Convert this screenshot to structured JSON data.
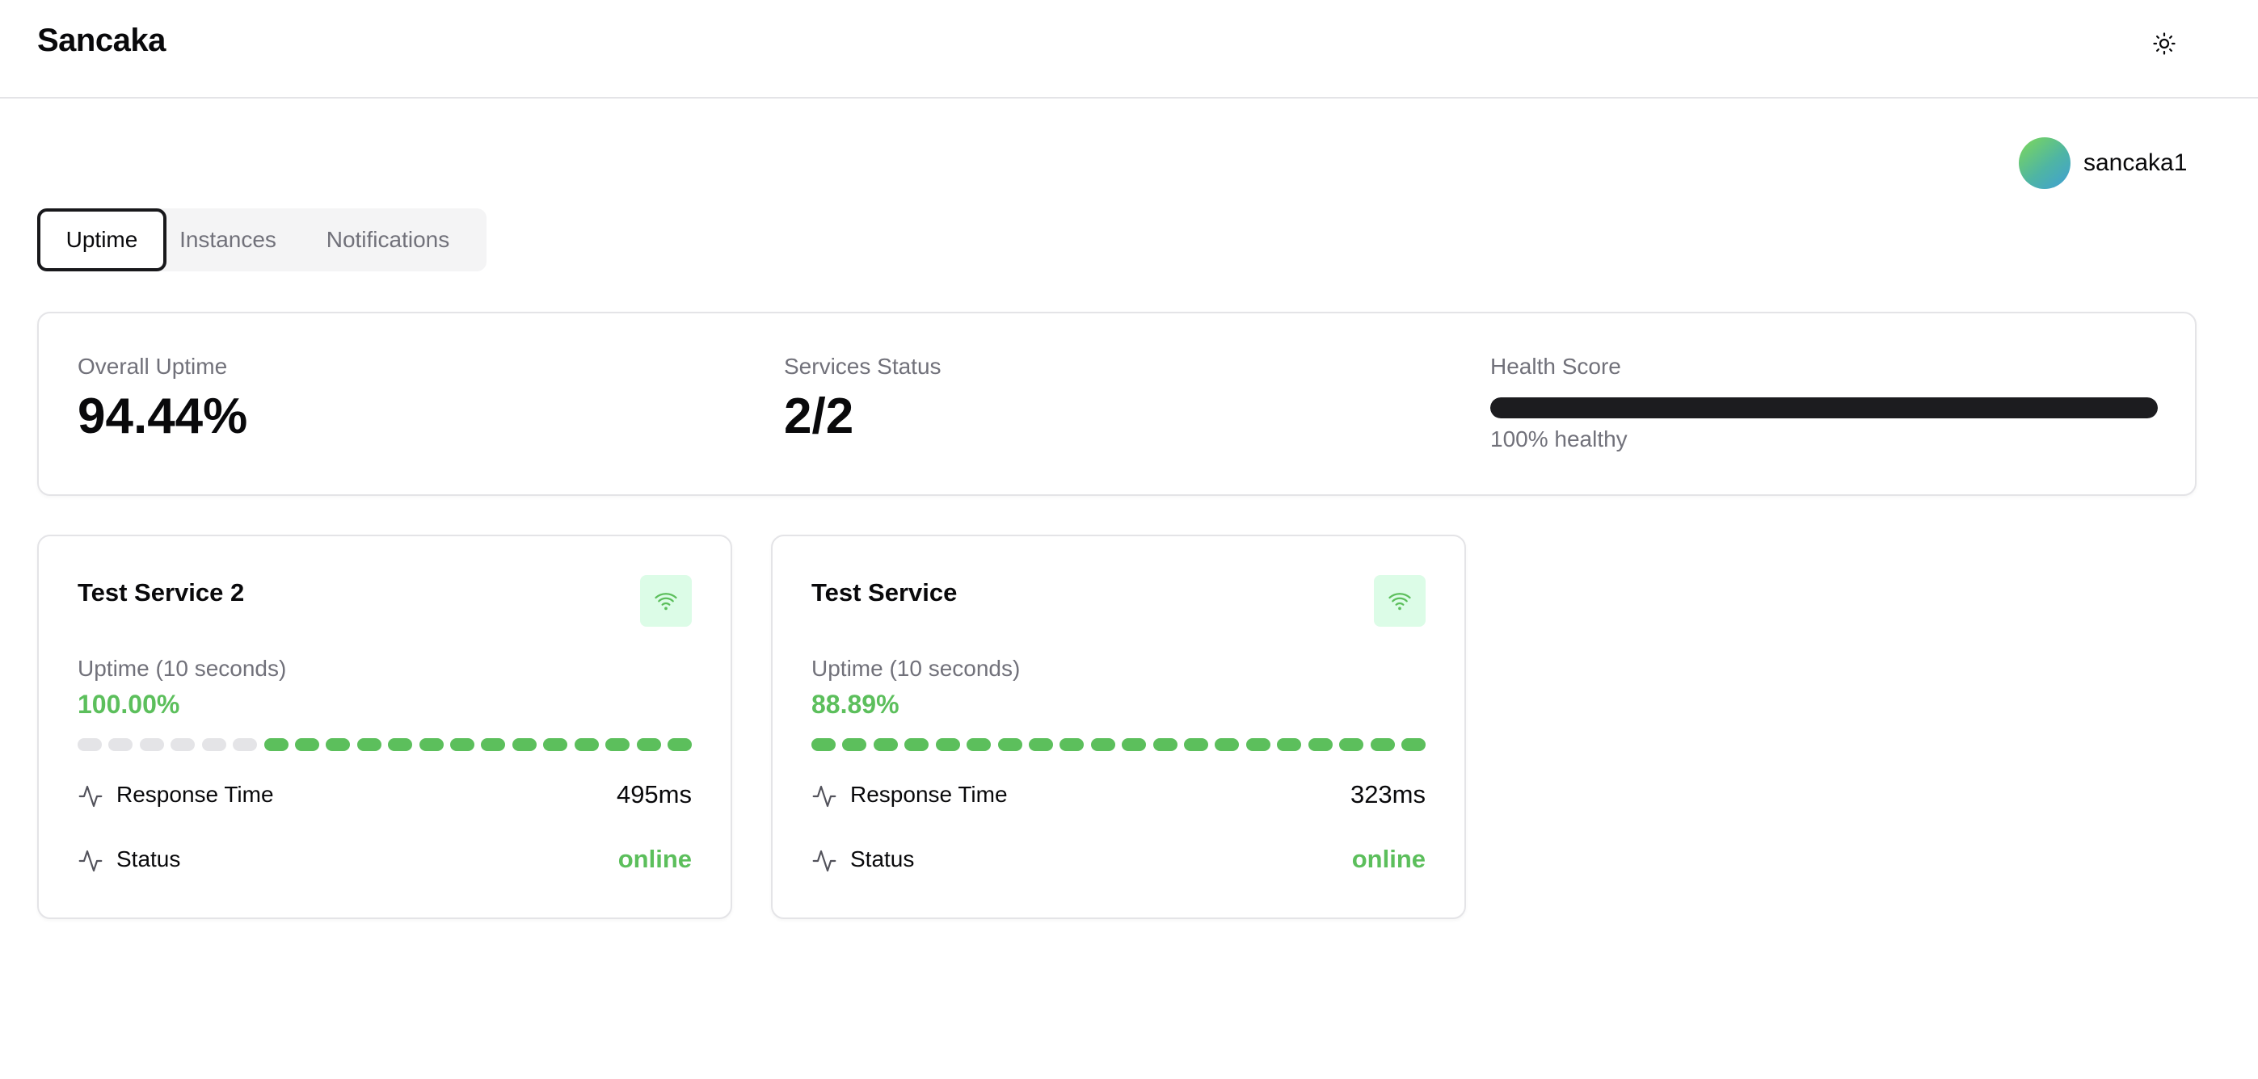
{
  "app": {
    "title": "Sancaka"
  },
  "header": {
    "theme_icon": "sun-icon"
  },
  "user": {
    "name": "sancaka1"
  },
  "tabs": [
    {
      "label": "Uptime",
      "active": true
    },
    {
      "label": "Instances",
      "active": false
    },
    {
      "label": "Notifications",
      "active": false
    }
  ],
  "summary": {
    "overall_uptime_label": "Overall Uptime",
    "overall_uptime_value": "94.44%",
    "services_status_label": "Services Status",
    "services_status_value": "2/2",
    "health_label": "Health Score",
    "health_percent": 100,
    "health_text": "100% healthy"
  },
  "services": [
    {
      "name": "Test Service 2",
      "status_icon": "wifi-icon",
      "uptime_label": "Uptime (10 seconds)",
      "uptime_value": "100.00%",
      "beats": [
        "empty",
        "empty",
        "empty",
        "empty",
        "empty",
        "empty",
        "up",
        "up",
        "up",
        "up",
        "up",
        "up",
        "up",
        "up",
        "up",
        "up",
        "up",
        "up",
        "up",
        "up"
      ],
      "response_label": "Response Time",
      "response_value": "495ms",
      "status_label": "Status",
      "status_value": "online"
    },
    {
      "name": "Test Service",
      "status_icon": "wifi-icon",
      "uptime_label": "Uptime (10 seconds)",
      "uptime_value": "88.89%",
      "beats": [
        "up",
        "up",
        "up",
        "up",
        "up",
        "up",
        "up",
        "up",
        "up",
        "up",
        "up",
        "up",
        "up",
        "up",
        "up",
        "up",
        "up",
        "up",
        "up",
        "up"
      ],
      "response_label": "Response Time",
      "response_value": "323ms",
      "status_label": "Status",
      "status_value": "online"
    }
  ],
  "colors": {
    "success": "#5cbf5c",
    "beat_empty": "#e4e4e7",
    "health_fill": "#1c1c1f",
    "icon_bg": "#dcfce7"
  }
}
